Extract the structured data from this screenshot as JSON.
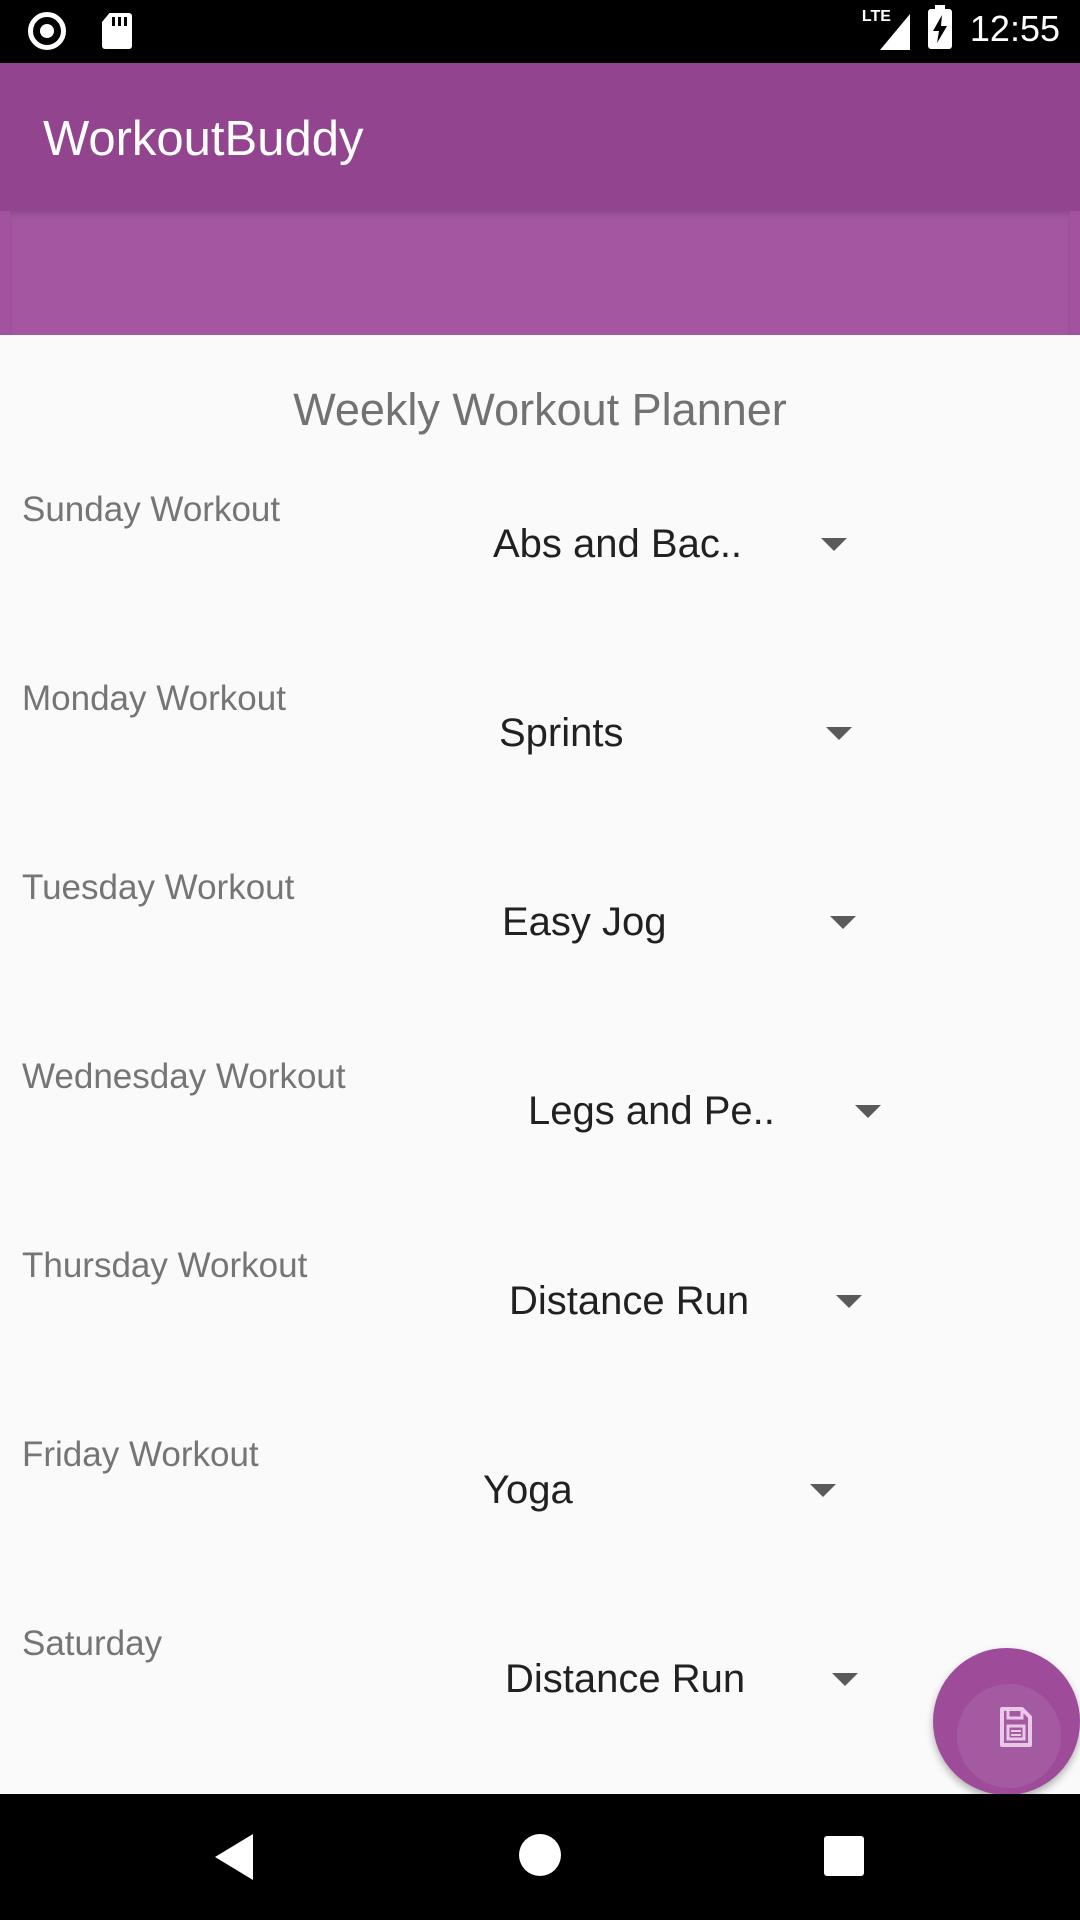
{
  "status_bar": {
    "network_label": "LTE",
    "time": "12:55",
    "icons": [
      "record-icon",
      "sd-card-icon",
      "lte-signal-icon",
      "battery-charging-icon"
    ]
  },
  "app_bar": {
    "title": "WorkoutBuddy",
    "color": "#93448f"
  },
  "main": {
    "title": "Weekly Workout Planner",
    "rows": [
      {
        "label": "Sunday Workout",
        "value": "Abs and Bac.."
      },
      {
        "label": "Monday Workout",
        "value": "Sprints"
      },
      {
        "label": "Tuesday Workout",
        "value": "Easy Jog"
      },
      {
        "label": "Wednesday Workout",
        "value": "Legs and Pe.."
      },
      {
        "label": "Thursday Workout",
        "value": "Distance Run"
      },
      {
        "label": "Friday Workout",
        "value": "Yoga"
      },
      {
        "label": "Saturday",
        "value": "Distance Run"
      }
    ]
  },
  "fab": {
    "icon": "save-icon",
    "color": "#9e4c9a"
  },
  "nav_bar": {
    "icons": [
      "back-icon",
      "home-icon",
      "recents-icon"
    ]
  }
}
